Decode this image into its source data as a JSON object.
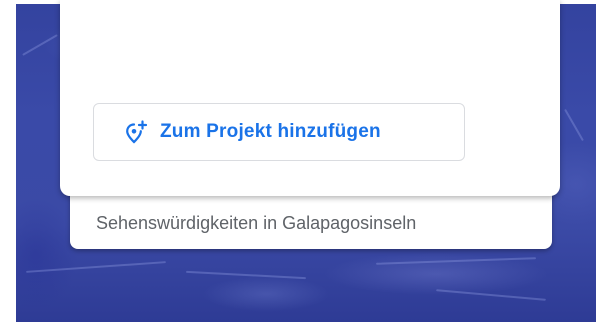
{
  "place_card": {
    "add_to_project_label": "Zum Projekt hinzufügen",
    "add_to_project_icon": "add-location-icon"
  },
  "caption": {
    "text": "Sehenswürdigkeiten in Galapagosinseln"
  },
  "colors": {
    "accent": "#1a73e8",
    "ocean": "#3a4aa8",
    "caption_text": "#5f6368"
  }
}
